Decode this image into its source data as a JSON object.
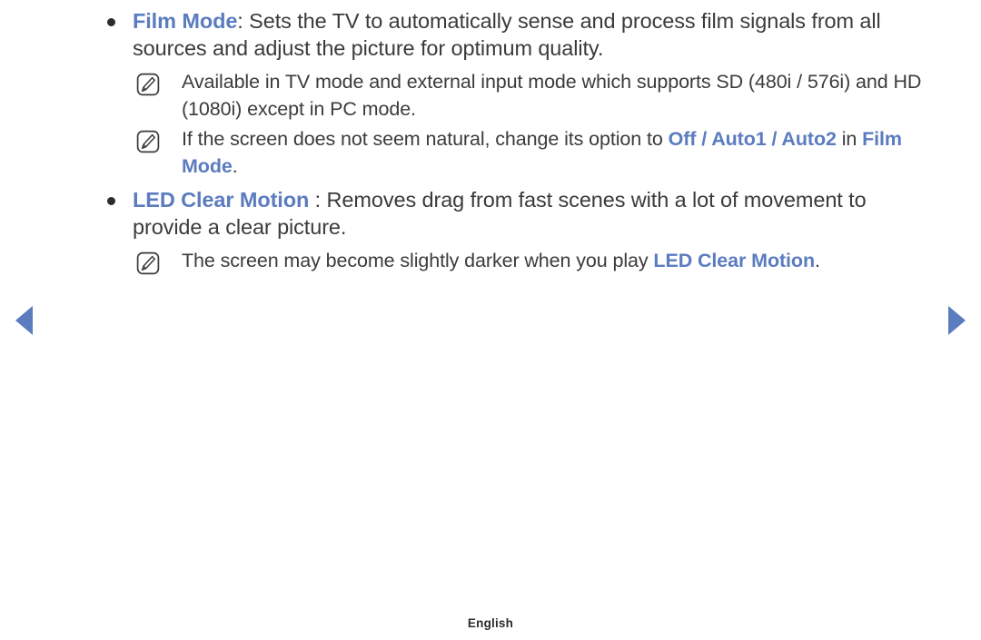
{
  "page": {
    "language_footer": "English"
  },
  "nav": {
    "prev_label": "Previous page",
    "next_label": "Next page"
  },
  "icons": {
    "note": "note-pencil-icon",
    "prev": "triangle-left-icon",
    "next": "triangle-right-icon",
    "bullet": "bullet-dot-icon"
  },
  "colors": {
    "accent_blue": "#5b7cbf",
    "body_text": "#3b3b3b",
    "background": "#ffffff"
  },
  "content": {
    "items": [
      {
        "type": "bullet",
        "term": "Film Mode",
        "body": ": Sets the TV to automatically sense and process film signals from all sources and adjust the picture for optimum quality."
      },
      {
        "type": "note",
        "body": "Available in TV mode and external input mode which supports SD (480i / 576i) and HD (1080i) except in PC mode."
      },
      {
        "type": "note",
        "lead": "If the screen does not seem natural, change its option to ",
        "option1": "Off / Auto1 / Auto2",
        "mid": " in ",
        "option2": "Film Mode",
        "tail": "."
      },
      {
        "type": "bullet",
        "term": "LED Clear Motion",
        "body": " : Removes drag from fast scenes with a lot of movement to provide a clear picture."
      },
      {
        "type": "note",
        "lead": "The screen may become slightly darker when you play ",
        "option1": "LED Clear Motion",
        "tail": "."
      }
    ]
  }
}
